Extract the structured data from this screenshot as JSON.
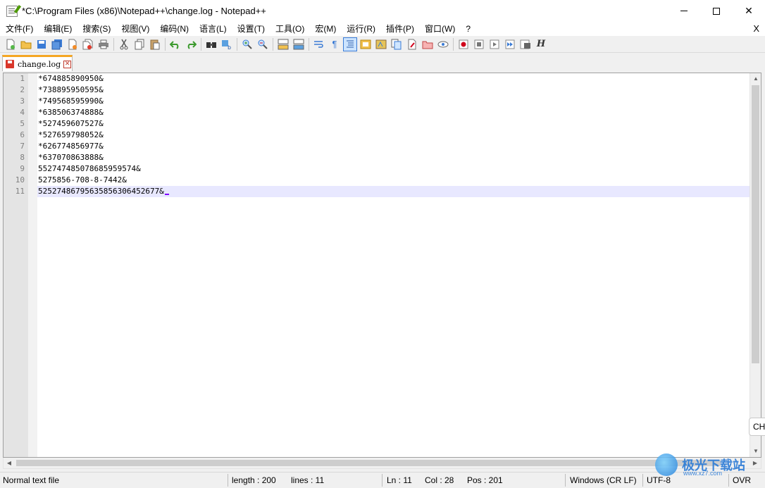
{
  "window": {
    "title": "*C:\\Program Files (x86)\\Notepad++\\change.log - Notepad++",
    "controls": {
      "minimize": "—",
      "maximize": "☐",
      "close": "✕"
    }
  },
  "menu": {
    "items": [
      "文件(F)",
      "编辑(E)",
      "搜索(S)",
      "视图(V)",
      "编码(N)",
      "语言(L)",
      "设置(T)",
      "工具(O)",
      "宏(M)",
      "运行(R)",
      "插件(P)",
      "窗口(W)",
      "?"
    ],
    "close_label": "X"
  },
  "toolbar": {
    "icons": [
      "new-file-icon",
      "open-file-icon",
      "save-icon",
      "save-all-icon",
      "close-icon",
      "close-all-icon",
      "print-icon",
      "cut-icon",
      "copy-icon",
      "paste-icon",
      "undo-icon",
      "redo-icon",
      "find-icon",
      "replace-icon",
      "zoom-in-icon",
      "zoom-out-icon",
      "sync-vertical-icon",
      "sync-horizontal-icon",
      "word-wrap-icon",
      "show-all-chars-icon",
      "indent-guide-icon",
      "doc-map-icon",
      "function-list-icon",
      "folder-workspace-icon",
      "doc-list-icon",
      "pdf-icon",
      "monitor-icon",
      "eye-icon",
      "record-macro-icon",
      "stop-macro-icon",
      "play-macro-icon",
      "run-macro-multiple-icon",
      "save-macro-icon",
      "italic-h-icon"
    ],
    "colors": {
      "record": "#d0021b",
      "accent": "#f5a623"
    }
  },
  "tab": {
    "label": "change.log",
    "close_glyph": "✕"
  },
  "editor": {
    "lines": [
      "*674885890950&",
      "*738895950595&",
      "*749568595990&",
      "*638506374888&",
      "*527459607527&",
      "*527659798052&",
      "*626774856977&",
      "*637070863888&",
      "552747485078685959574&",
      "5275856-708-8-7442&",
      "52527486795635856306452677&"
    ],
    "current_line": 11,
    "line_numbers": [
      "1",
      "2",
      "3",
      "4",
      "5",
      "6",
      "7",
      "8",
      "9",
      "10",
      "11"
    ]
  },
  "status": {
    "file_type": "Normal text file",
    "length": "length : 200",
    "lines": "lines : 11",
    "ln": "Ln : 11",
    "col": "Col : 28",
    "pos": "Pos : 201",
    "eol": "Windows (CR LF)",
    "encoding": "UTF-8",
    "mode": "OVR"
  },
  "ime": {
    "label": "CH"
  },
  "watermark": {
    "text": "极光下载站",
    "url": "www.xz7.com"
  }
}
